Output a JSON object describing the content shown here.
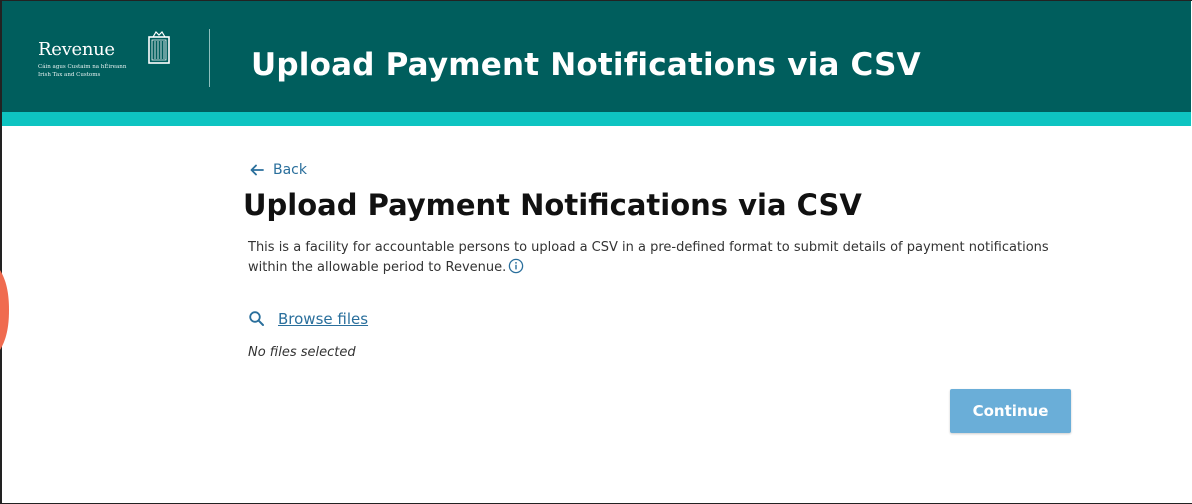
{
  "colors": {
    "header_bg": "#005e5d",
    "accent_stripe": "#0ec4c1",
    "link": "#2a6f9c",
    "button_bg": "#6aaed8"
  },
  "logo": {
    "word": "Revenue",
    "line1": "Cáin agus Custaim na hÉireann",
    "line2": "Irish Tax and Customs",
    "icon": "harp-icon"
  },
  "header": {
    "title": "Upload Payment Notifications via CSV"
  },
  "main": {
    "back_label": "Back",
    "back_icon": "arrow-left-icon",
    "title": "Upload Payment Notifications via CSV",
    "description": "This is a facility for accountable persons to upload a CSV in a pre-defined format to submit details of payment notifications within the allowable period to Revenue.",
    "info_icon": "info-icon",
    "browse_label": "Browse files",
    "browse_icon": "search-icon",
    "no_files_text": "No files selected",
    "continue_label": "Continue"
  }
}
